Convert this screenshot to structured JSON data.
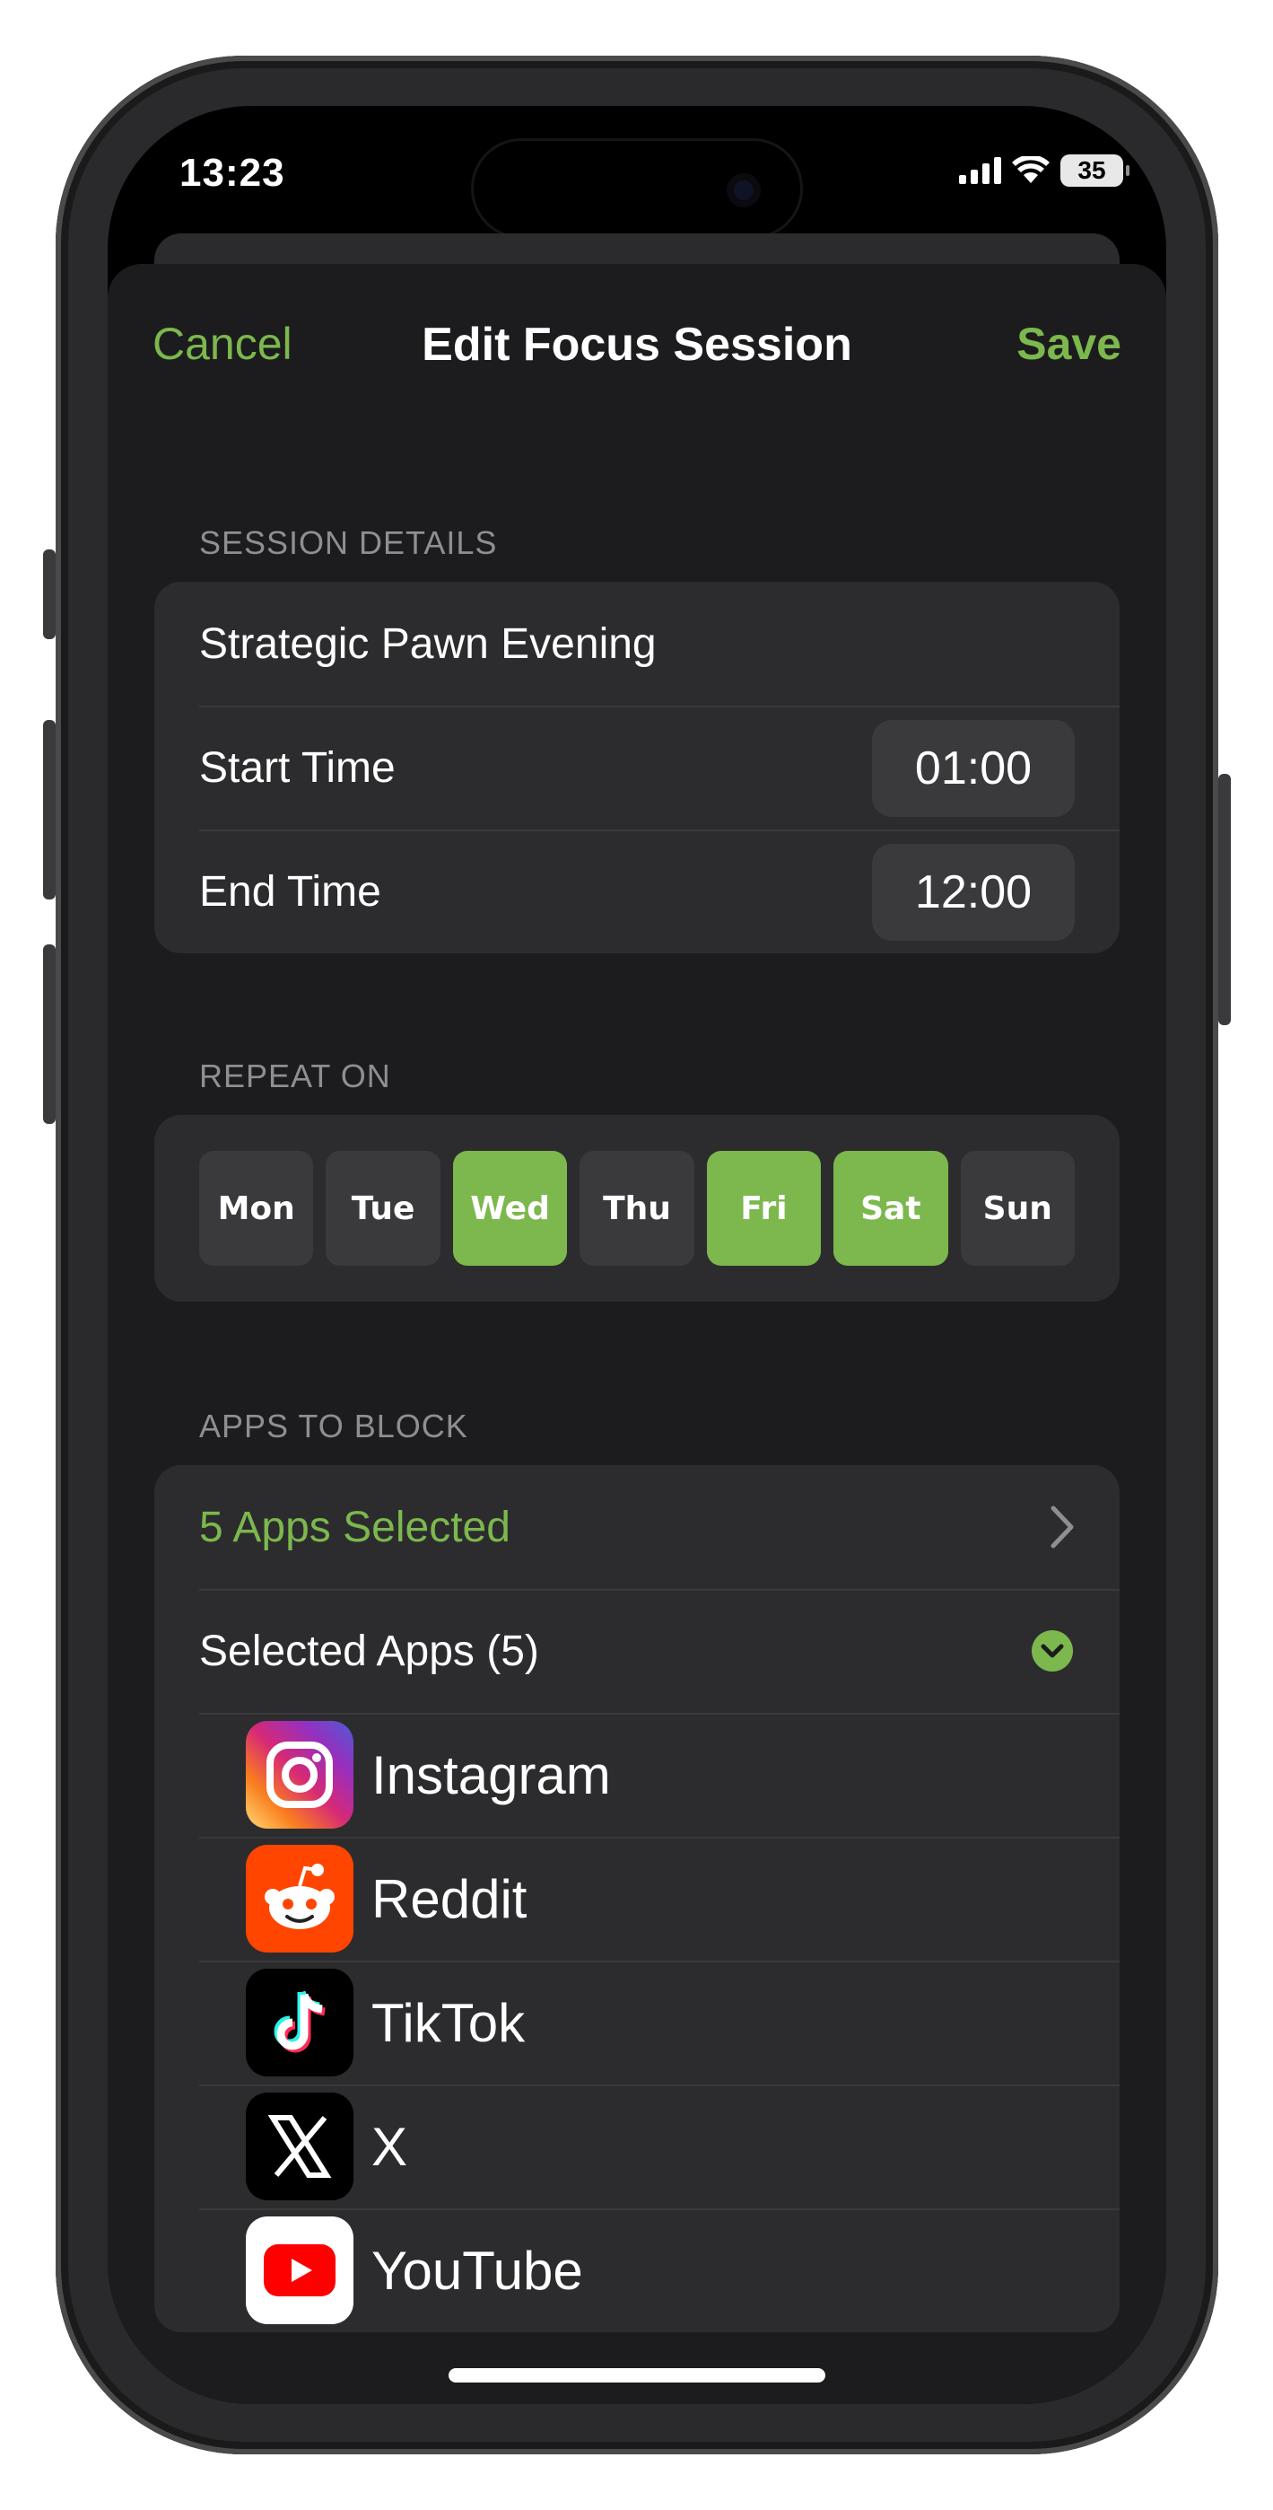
{
  "status": {
    "time": "13:23",
    "battery": "35"
  },
  "nav": {
    "cancel": "Cancel",
    "title": "Edit Focus Session",
    "save": "Save"
  },
  "details": {
    "header": "SESSION DETAILS",
    "name": "Strategic Pawn Evening",
    "start_label": "Start Time",
    "start_value": "01:00",
    "end_label": "End Time",
    "end_value": "12:00"
  },
  "repeat": {
    "header": "REPEAT ON",
    "days": [
      {
        "label": "Mon",
        "selected": false
      },
      {
        "label": "Tue",
        "selected": false
      },
      {
        "label": "Wed",
        "selected": true
      },
      {
        "label": "Thu",
        "selected": false
      },
      {
        "label": "Fri",
        "selected": true
      },
      {
        "label": "Sat",
        "selected": true
      },
      {
        "label": "Sun",
        "selected": false
      }
    ]
  },
  "apps": {
    "header": "APPS TO BLOCK",
    "selected_summary": "5 Apps Selected",
    "selected_list_label": "Selected Apps (5)",
    "items": [
      {
        "name": "Instagram",
        "icon": "instagram-icon"
      },
      {
        "name": "Reddit",
        "icon": "reddit-icon"
      },
      {
        "name": "TikTok",
        "icon": "tiktok-icon"
      },
      {
        "name": "X",
        "icon": "x-icon"
      },
      {
        "name": "YouTube",
        "icon": "youtube-icon"
      }
    ]
  },
  "colors": {
    "accent": "#7cb84d",
    "sheet": "#1c1c1e",
    "group": "#2c2c2e",
    "pill": "#3a3a3c"
  }
}
